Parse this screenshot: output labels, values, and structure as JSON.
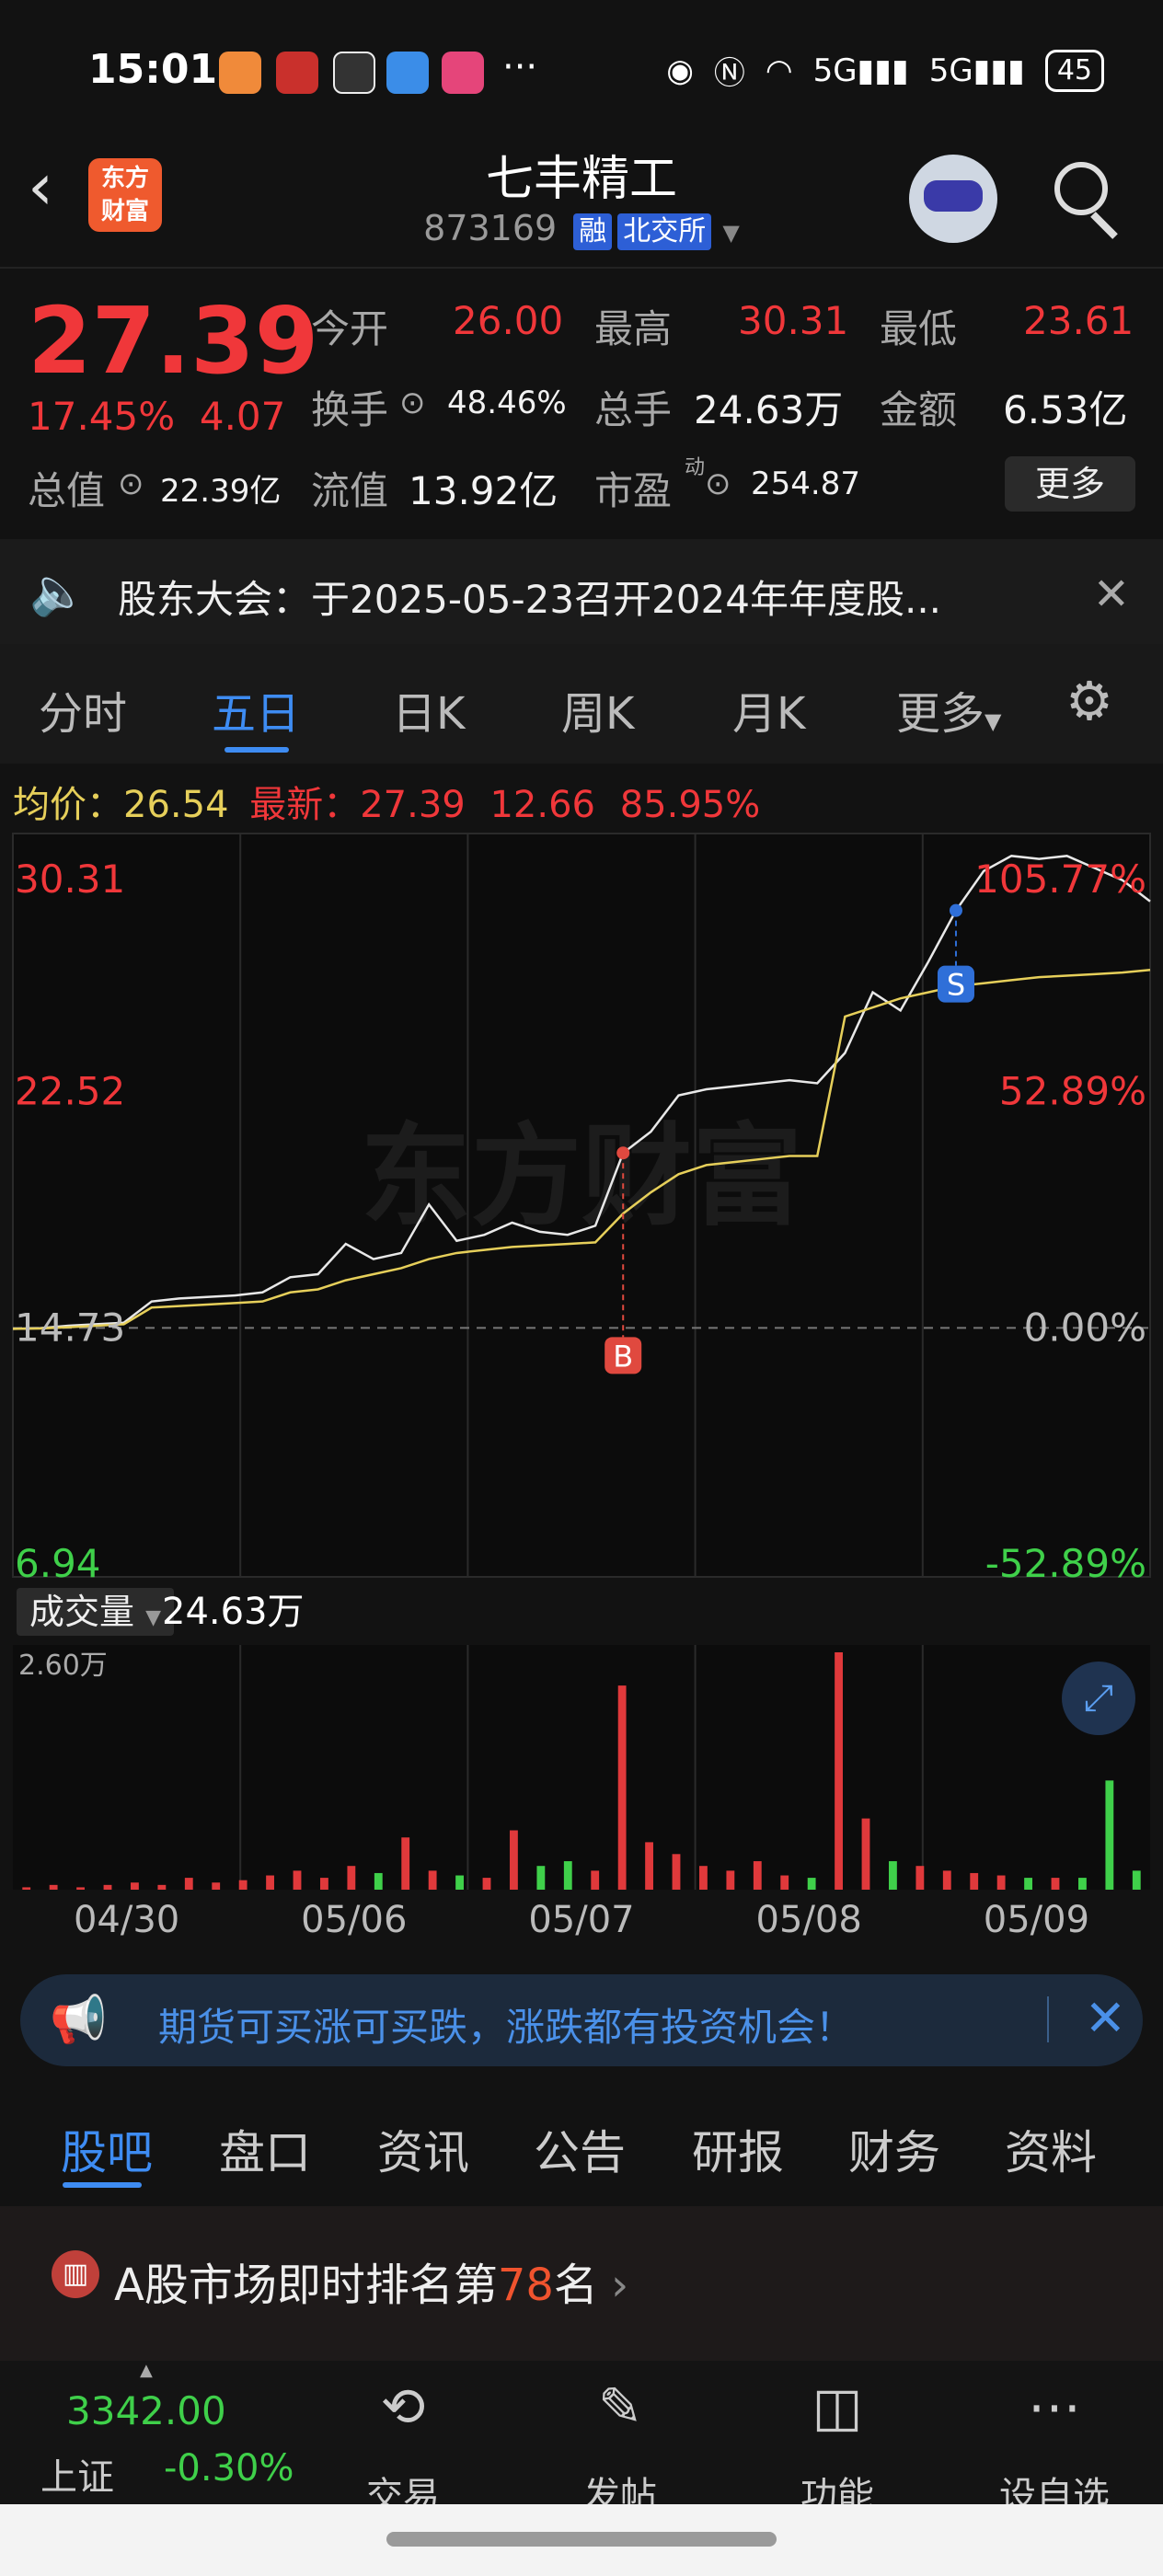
{
  "status_bar": {
    "time": "15:01",
    "battery": "45",
    "network": "5G"
  },
  "header": {
    "title": "七丰精工",
    "code": "873169",
    "tags": [
      "融",
      "北交所"
    ],
    "logo_text": [
      "东方",
      "财富"
    ]
  },
  "quote": {
    "price": "27.39",
    "change_pct": "17.45%",
    "change": "4.07",
    "fields": {
      "open_label": "今开",
      "open": "26.00",
      "high_label": "最高",
      "high": "30.31",
      "low_label": "最低",
      "low": "23.61",
      "turnover_label": "换手",
      "turnover": "48.46%",
      "volume_label": "总手",
      "volume": "24.63万",
      "amount_label": "金额",
      "amount": "6.53亿",
      "mktcap_label": "总值",
      "mktcap": "22.39亿",
      "float_label": "流值",
      "float_cap": "13.92亿",
      "pe_label": "市盈",
      "pe_sup": "动",
      "pe": "254.87"
    },
    "more_label": "更多"
  },
  "notice": {
    "text": "股东大会：于2025-05-23召开2024年年度股..."
  },
  "chart_tabs": [
    "分时",
    "五日",
    "日K",
    "周K",
    "月K",
    "更多"
  ],
  "active_chart_tab": "五日",
  "info_row": {
    "avg_label": "均价：",
    "avg": "26.54",
    "last_label": "最新：",
    "last": "27.39",
    "change": "12.66",
    "change_pct": "85.95%"
  },
  "chart_data": {
    "type": "line",
    "y_left_ticks": [
      "30.31",
      "22.52",
      "14.73",
      "6.94"
    ],
    "y_right_ticks": [
      "105.77%",
      "52.89%",
      "0.00%",
      "-52.89%"
    ],
    "x_labels": [
      "04/30",
      "05/06",
      "05/07",
      "05/08",
      "05/09"
    ],
    "ylim": [
      6.94,
      30.31
    ],
    "prev_close": 14.73,
    "series": [
      {
        "values": [
          14.7,
          14.72,
          14.8,
          14.85,
          14.9,
          15.6,
          15.7,
          15.75,
          15.8,
          15.9,
          16.4,
          16.5,
          17.5,
          17.0,
          17.2,
          18.8,
          17.6,
          17.8,
          18.2,
          17.9,
          17.8,
          18.1,
          20.5,
          21.2,
          22.4,
          22.6,
          22.7,
          22.8,
          22.9,
          22.8,
          23.8,
          25.8,
          25.2,
          26.8,
          28.5,
          29.8,
          30.3,
          30.2,
          30.3,
          29.9,
          29.5,
          28.8
        ]
      },
      {
        "values": [
          14.7,
          14.71,
          14.75,
          14.8,
          14.85,
          15.4,
          15.45,
          15.5,
          15.55,
          15.6,
          15.9,
          16.0,
          16.3,
          16.5,
          16.7,
          17.0,
          17.2,
          17.3,
          17.4,
          17.45,
          17.5,
          17.55,
          18.5,
          19.2,
          19.8,
          20.1,
          20.2,
          20.3,
          20.4,
          20.4,
          25.0,
          25.3,
          25.6,
          25.8,
          26.0,
          26.1,
          26.2,
          26.3,
          26.35,
          26.4,
          26.45,
          26.54
        ]
      }
    ],
    "markers": [
      {
        "label": "B",
        "color": "#e0493f",
        "type": "buy"
      },
      {
        "label": "S",
        "color": "#2f6fd8",
        "type": "sell"
      }
    ],
    "watermark": "东方财富"
  },
  "volume": {
    "label": "成交量",
    "total": "24.63万",
    "max_label": "2.60万",
    "bars": [
      0.01,
      0.02,
      0.01,
      0.02,
      0.03,
      0.02,
      0.05,
      0.03,
      0.04,
      0.06,
      0.08,
      0.05,
      0.1,
      0.07,
      0.22,
      0.08,
      0.06,
      0.05,
      0.25,
      0.1,
      0.12,
      0.08,
      0.86,
      0.2,
      0.15,
      0.1,
      0.08,
      0.12,
      0.06,
      0.05,
      1.0,
      0.3,
      0.12,
      0.1,
      0.08,
      0.07,
      0.06,
      0.05,
      0.05,
      0.05,
      0.46,
      0.08
    ]
  },
  "ad": {
    "text": "期货可买涨可买跌，涨跌都有投资机会！"
  },
  "bottom_tabs": [
    "股吧",
    "盘口",
    "资讯",
    "公告",
    "研报",
    "财务",
    "资料"
  ],
  "rank": {
    "prefix": "A股市场即时排名第",
    "number": "78",
    "suffix": "名"
  },
  "bottom_nav": {
    "index_value": "3342.00",
    "index_name": "上证",
    "index_change": "-0.30%",
    "items": [
      "交易",
      "发帖",
      "功能",
      "设自选"
    ]
  },
  "colors": {
    "up": "#f0373a",
    "down": "#3fd04a",
    "accent": "#3e8cf2",
    "avg_line": "#e6cf5a"
  }
}
